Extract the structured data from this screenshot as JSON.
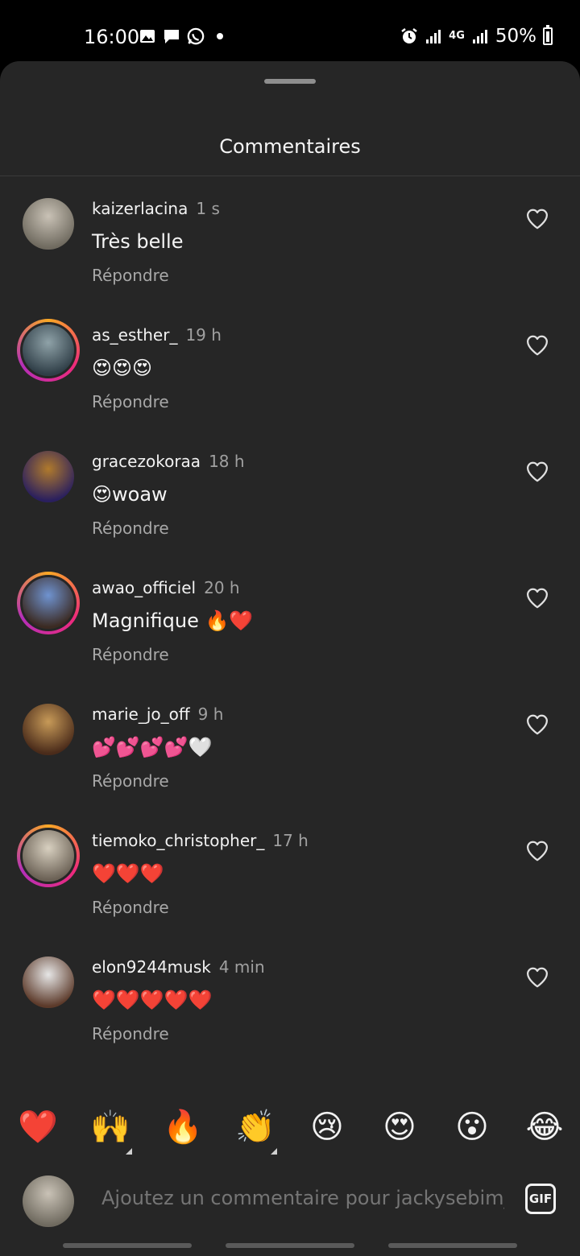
{
  "status_bar": {
    "time": "16:00",
    "left_icons": [
      "gallery-icon",
      "message-icon",
      "whatsapp-icon",
      "dot-icon"
    ],
    "right_icons": [
      "alarm-icon",
      "signal-icon",
      "4g-icon",
      "signal-icon"
    ],
    "network": "4G",
    "battery": "50%"
  },
  "sheet": {
    "title": "Commentaires"
  },
  "comments": [
    {
      "username": "kaizerlacina",
      "time": "1 s",
      "text": "Très belle",
      "reply": "Répondre",
      "story_ring": false,
      "avatar_colors": [
        "#6f6a5f",
        "#c9c2b6"
      ]
    },
    {
      "username": "as_esther_",
      "time": "19 h",
      "text": "😍😍😍",
      "reply": "Répondre",
      "story_ring": true,
      "avatar_colors": [
        "#2f3e47",
        "#8fa2a8"
      ]
    },
    {
      "username": "gracezokoraa",
      "time": "18 h",
      "text": "😍woaw",
      "reply": "Répondre",
      "story_ring": false,
      "avatar_colors": [
        "#2a1f5e",
        "#b07a2c"
      ]
    },
    {
      "username": "awao_officiel",
      "time": "20 h",
      "text": "Magnifique 🔥❤️",
      "reply": "Répondre",
      "story_ring": true,
      "avatar_colors": [
        "#3b2a22",
        "#6f93d0"
      ]
    },
    {
      "username": "marie_jo_off",
      "time": "9 h",
      "text": "💕💕💕💕🤍",
      "reply": "Répondre",
      "story_ring": false,
      "avatar_colors": [
        "#4a2b1a",
        "#c79a58"
      ]
    },
    {
      "username": "tiemoko_christopher_",
      "time": "17 h",
      "text": "❤️❤️❤️",
      "reply": "Répondre",
      "story_ring": true,
      "avatar_colors": [
        "#6b6155",
        "#d8d0c0"
      ]
    },
    {
      "username": "elon9244musk",
      "time": "4 min",
      "text": "❤️❤️❤️❤️❤️",
      "reply": "Répondre",
      "story_ring": false,
      "avatar_colors": [
        "#5c3a2a",
        "#e6e6e6"
      ]
    }
  ],
  "emoji_bar": [
    "❤️",
    "🙌",
    "🔥",
    "👏",
    "😢",
    "😍",
    "😮",
    "😂"
  ],
  "input": {
    "placeholder": "Ajoutez un commentaire pour jackysebim__",
    "gif_label": "GIF",
    "avatar_colors": [
      "#6f6a5f",
      "#c9c2b6"
    ]
  }
}
